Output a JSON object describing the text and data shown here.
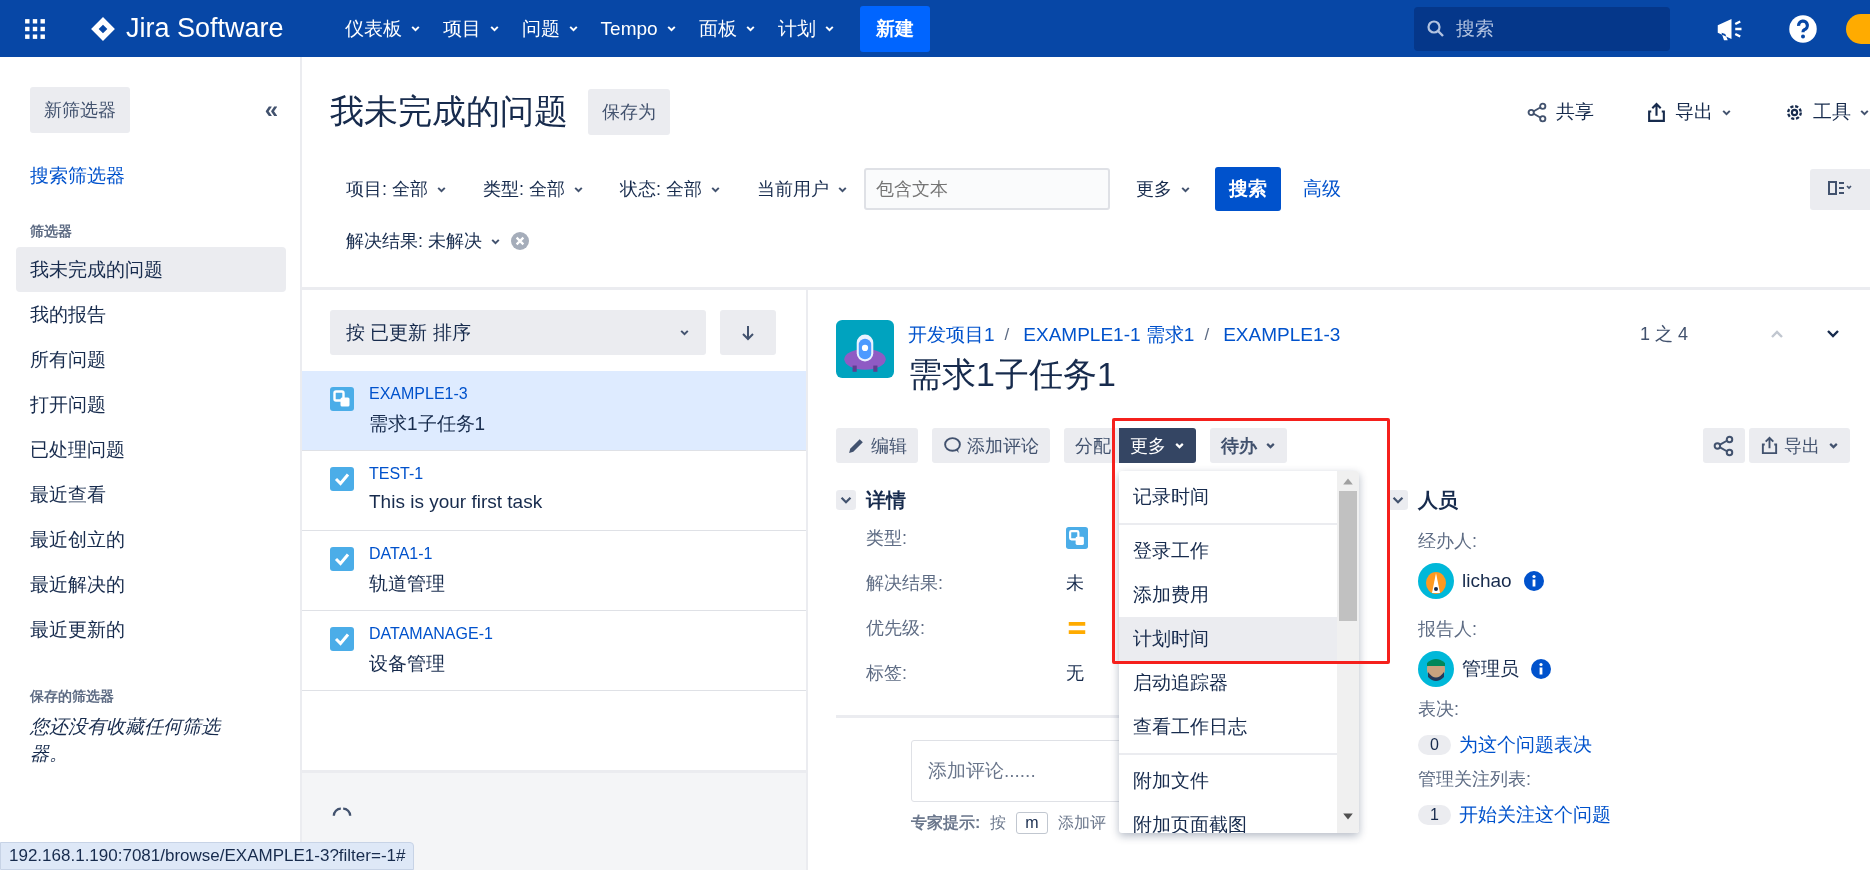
{
  "topbar": {
    "product": "Jira Software",
    "nav": [
      {
        "label": "仪表板"
      },
      {
        "label": "项目"
      },
      {
        "label": "问题"
      },
      {
        "label": "Tempo"
      },
      {
        "label": "面板"
      },
      {
        "label": "计划"
      }
    ],
    "create": "新建",
    "search": {
      "placeholder": "搜索"
    }
  },
  "sidebar": {
    "new_filter": "新筛选器",
    "collapse": "«",
    "search_filters": "搜索筛选器",
    "filters_heading": "筛选器",
    "filters": [
      {
        "label": "我未完成的问题",
        "selected": true
      },
      {
        "label": "我的报告",
        "selected": false
      },
      {
        "label": "所有问题",
        "selected": false
      },
      {
        "label": "打开问题",
        "selected": false
      },
      {
        "label": "已处理问题",
        "selected": false
      },
      {
        "label": "最近查看",
        "selected": false
      },
      {
        "label": "最近创立的",
        "selected": false
      },
      {
        "label": "最近解决的",
        "selected": false
      },
      {
        "label": "最近更新的",
        "selected": false
      }
    ],
    "saved_heading": "保存的筛选器",
    "saved_empty": "您还没有收藏任何筛选器。"
  },
  "header": {
    "title": "我未完成的问题",
    "save_as": "保存为",
    "actions": [
      {
        "kind": "share",
        "label": "共享"
      },
      {
        "kind": "export",
        "label": "导出"
      },
      {
        "kind": "tools",
        "label": "工具"
      }
    ]
  },
  "filters": {
    "chips": [
      {
        "label": "项目: 全部"
      },
      {
        "label": "类型: 全部"
      },
      {
        "label": "状态: 全部"
      },
      {
        "label": "当前用户"
      }
    ],
    "text": {
      "placeholder": "包含文本"
    },
    "more": "更多",
    "search": "搜索",
    "advanced": "高级",
    "resolution": "解决结果: 未解决"
  },
  "issue_list": {
    "sort": "按 已更新 排序",
    "issues": [
      {
        "key": "EXAMPLE1-3",
        "summary": "需求1子任务1",
        "kind": "subtask",
        "selected": true
      },
      {
        "key": "TEST-1",
        "summary": "This is your first task",
        "kind": "task",
        "selected": false
      },
      {
        "key": "DATA1-1",
        "summary": "轨道管理",
        "kind": "task",
        "selected": false
      },
      {
        "key": "DATAMANAGE-1",
        "summary": "设备管理",
        "kind": "task",
        "selected": false
      }
    ]
  },
  "issue": {
    "breadcrumbs": [
      {
        "label": "开发项目1",
        "separator": "/"
      },
      {
        "label": "EXAMPLE1-1 需求1",
        "separator": "/"
      },
      {
        "label": "EXAMPLE1-3"
      }
    ],
    "title": "需求1子任务1",
    "pager": "1 之 4",
    "toolbar": [
      {
        "kind": "edit",
        "label": "编辑"
      },
      {
        "kind": "comment",
        "label": "添加评论"
      },
      {
        "kind": "assign",
        "label": "分配"
      },
      {
        "kind": "menu",
        "label": "更多",
        "open": true
      },
      {
        "kind": "status",
        "label": "待办"
      }
    ],
    "export": "导出",
    "details": {
      "heading": "详情",
      "fields": [
        {
          "label": "类型:",
          "kind": "type"
        },
        {
          "label": "解决结果:",
          "kind": "text",
          "value": "未"
        },
        {
          "label": "优先级:",
          "kind": "priority"
        },
        {
          "label": "标签:",
          "kind": "text",
          "value": "无"
        }
      ]
    },
    "comment": {
      "placeholder": "添加评论......",
      "tip_label": "专家提示:",
      "tip_press": "按",
      "tip_key": "m",
      "tip_rest": "添加评"
    },
    "menu": {
      "groups": [
        {
          "items": [
            {
              "label": "记录时间",
              "selected": false
            }
          ]
        },
        {
          "items": [
            {
              "label": "登录工作",
              "selected": false
            },
            {
              "label": "添加费用",
              "selected": false
            },
            {
              "label": "计划时间",
              "selected": true
            },
            {
              "label": "启动追踪器",
              "selected": false
            },
            {
              "label": "查看工作日志",
              "selected": false
            }
          ]
        },
        {
          "items": [
            {
              "label": "附加文件",
              "selected": false
            },
            {
              "label": "附加页面截图",
              "selected": false
            }
          ]
        }
      ]
    },
    "people": {
      "heading": "人员",
      "assignee_label": "经办人:",
      "assignee": "lichao",
      "reporter_label": "报告人:",
      "reporter": "管理员",
      "votes_label": "表决:",
      "votes": "0",
      "vote_link": "为这个问题表决",
      "watch_label": "管理关注列表:",
      "watchers": "1",
      "watch_link": "开始关注这个问题"
    }
  },
  "status_url": "192.168.1.190:7081/browse/EXAMPLE1-3?filter=-1#"
}
